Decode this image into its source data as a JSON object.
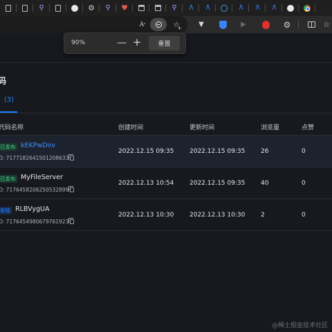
{
  "browser": {
    "tabs": [
      {
        "icon": "document-icon"
      },
      {
        "icon": "document-icon"
      },
      {
        "icon": "search-icon"
      },
      {
        "icon": "document-icon"
      },
      {
        "icon": "github-icon"
      },
      {
        "icon": "gear-icon"
      },
      {
        "icon": "search-icon"
      },
      {
        "icon": "heart-icon"
      },
      {
        "icon": "calendar-icon"
      },
      {
        "icon": "calendar-icon"
      },
      {
        "icon": "search-icon"
      },
      {
        "icon": "m-logo-icon"
      },
      {
        "icon": "m-logo-icon"
      },
      {
        "icon": "globe-icon"
      },
      {
        "icon": "m-logo-icon"
      },
      {
        "icon": "m-logo-icon"
      },
      {
        "icon": "m-logo-icon"
      },
      {
        "icon": "github-icon"
      },
      {
        "icon": "chrome-icon"
      }
    ],
    "toolbar": {
      "read_aloud_glyph": "A",
      "tri_glyph": "▼",
      "play_glyph": "▶",
      "puzzle_glyph": "⚙",
      "star_glyph": "☆",
      "plus_glyph": "+"
    }
  },
  "zoom_popup": {
    "value": "90%",
    "minus": "—",
    "plus": "+",
    "reset_label": "重置"
  },
  "page": {
    "title_partial": "码",
    "tab_label_partial": "(3)",
    "columns": [
      "代码名称",
      "创建时间",
      "更新时间",
      "浏览量",
      "点赞"
    ],
    "rows": [
      {
        "status": "已发布",
        "status_type": "published",
        "name": "kEKPwDov",
        "id": "D: 7177182641501208633",
        "created": "2022.12.15 09:35",
        "updated": "2022.12.15 09:35",
        "views": "26",
        "likes": "0"
      },
      {
        "status": "已发布",
        "status_type": "published",
        "name": "MyFileServer",
        "id": "D: 7176458206250532899",
        "created": "2022.12.13 10:54",
        "updated": "2022.12.15 09:35",
        "views": "40",
        "likes": "0"
      },
      {
        "status": "审核",
        "status_type": "auditing",
        "name": "RLBVygUA",
        "id": "D: 7176454980679761923",
        "created": "2022.12.13 10:30",
        "updated": "2022.12.13 10:30",
        "views": "2",
        "likes": "0"
      }
    ]
  },
  "watermark": "@稀土掘金技术社区",
  "colors": {
    "background": "#17191f",
    "accent": "#1e80ff",
    "published": "#3ecf8e"
  }
}
